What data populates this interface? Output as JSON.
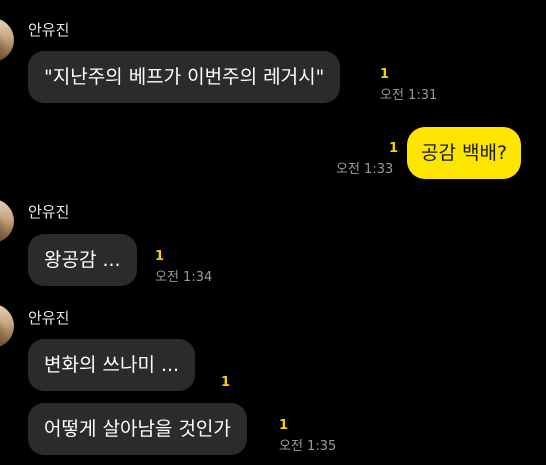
{
  "messages": [
    {
      "sender": "안유진",
      "text": "\"지난주의 베프가 이번주의 레거시\"",
      "unread": "1",
      "time": "오전 1:31"
    },
    {
      "text": "공감 백배?",
      "unread": "1",
      "time": "오전 1:33"
    },
    {
      "sender": "안유진",
      "text": "왕공감 ...",
      "unread": "1",
      "time": "오전 1:34"
    },
    {
      "sender": "안유진",
      "text": "변화의 쓰나미 ...",
      "unread": "1"
    },
    {
      "text": "어떻게 살아남을 것인가",
      "unread": "1",
      "time": "오전 1:35"
    }
  ],
  "colors": {
    "background": "#000000",
    "incoming_bubble": "#2b2b2b",
    "outgoing_bubble": "#fee500",
    "unread": "#f5d100",
    "time": "#9a9a9a"
  }
}
